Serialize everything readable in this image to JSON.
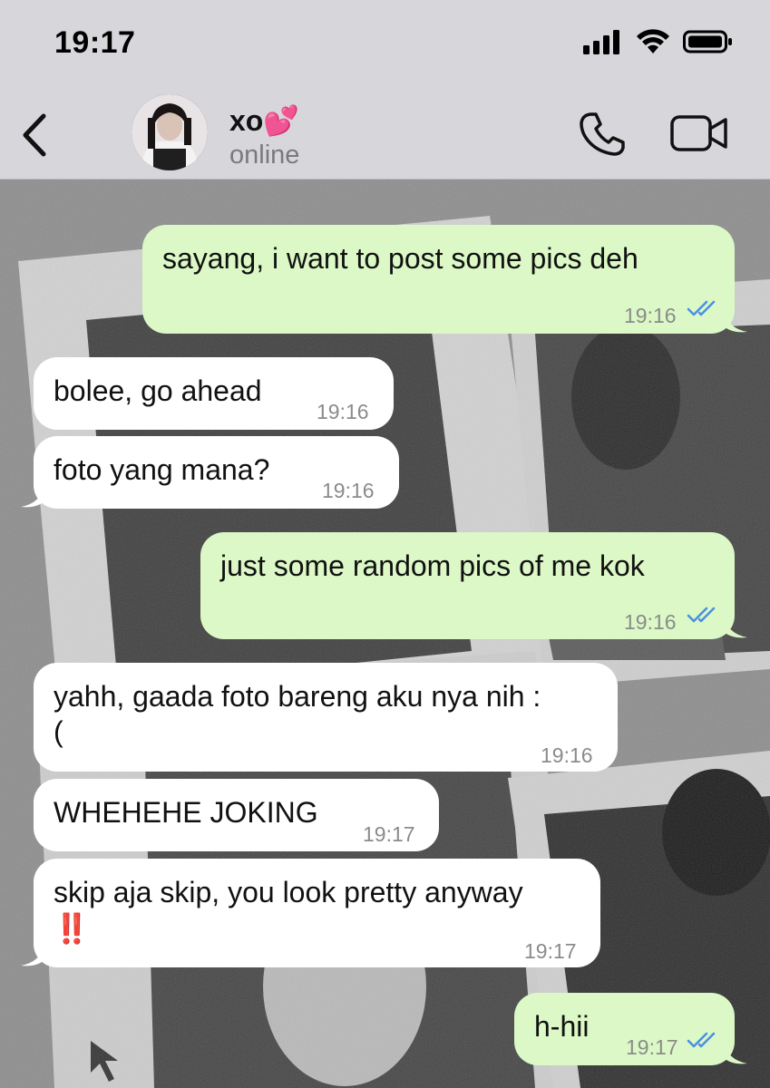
{
  "status_bar": {
    "time": "19:17"
  },
  "header": {
    "contact_name": "xo💕",
    "contact_status": "online"
  },
  "icons": {
    "back": "chevron-left-icon",
    "call": "phone-icon",
    "video": "video-camera-icon",
    "read_receipt": "double-check-icon",
    "signal": "signal-icon",
    "wifi": "wifi-icon",
    "battery": "battery-icon"
  },
  "colors": {
    "outgoing_bubble": "#dbf8c6",
    "incoming_bubble": "#ffffff",
    "header_bg": "#d7d6db",
    "read_tick": "#4a90e2"
  },
  "messages": [
    {
      "direction": "out",
      "text": "sayang, i want to post some pics deh",
      "time": "19:16",
      "read": true
    },
    {
      "direction": "in",
      "text": "bolee, go ahead",
      "time": "19:16"
    },
    {
      "direction": "in",
      "text": "foto yang mana?",
      "time": "19:16"
    },
    {
      "direction": "out",
      "text": "just some random pics of me kok",
      "time": "19:16",
      "read": true
    },
    {
      "direction": "in",
      "text_line1": "yahh, gaada foto bareng aku nya nih :",
      "text_line2": "(",
      "time": "19:16"
    },
    {
      "direction": "in",
      "text": "WHEHEHE JOKING",
      "time": "19:17"
    },
    {
      "direction": "in",
      "text_line1": "skip aja skip, you look pretty anyway",
      "text_line2": "‼️",
      "time": "19:17"
    },
    {
      "direction": "out",
      "text": "h-hii",
      "time": "19:17",
      "read": true
    }
  ]
}
